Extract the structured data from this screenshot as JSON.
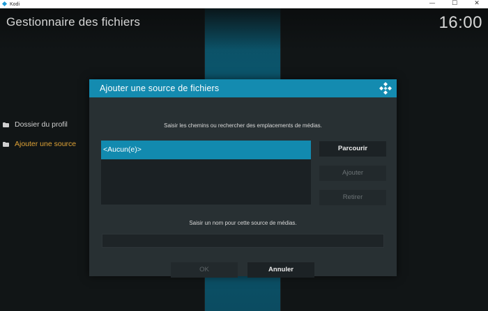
{
  "app": {
    "window_title": "Kodi",
    "controls": {
      "minimize": "—",
      "maximize": "☐",
      "close": "✕"
    }
  },
  "screen": {
    "title": "Gestionnaire des fichiers",
    "clock": "16:00"
  },
  "sidebar": {
    "items": [
      {
        "label": "Dossier du profil",
        "icon": "folder-icon",
        "active": false
      },
      {
        "label": "Ajouter une source",
        "icon": "folder-icon",
        "active": true
      }
    ]
  },
  "dialog": {
    "title": "Ajouter une source de fichiers",
    "paths_hint": "Saisir les chemins ou rechercher des emplacements de médias.",
    "paths": [
      "<Aucun(e)>"
    ],
    "buttons": {
      "browse": "Parcourir",
      "add": "Ajouter",
      "remove": "Retirer",
      "ok": "OK",
      "cancel": "Annuler"
    },
    "name_hint": "Saisir un nom pour cette source de médias.",
    "name_value": ""
  },
  "colors": {
    "accent": "#148bb0",
    "active_text": "#e0a336",
    "dialog_bg": "#283033"
  }
}
